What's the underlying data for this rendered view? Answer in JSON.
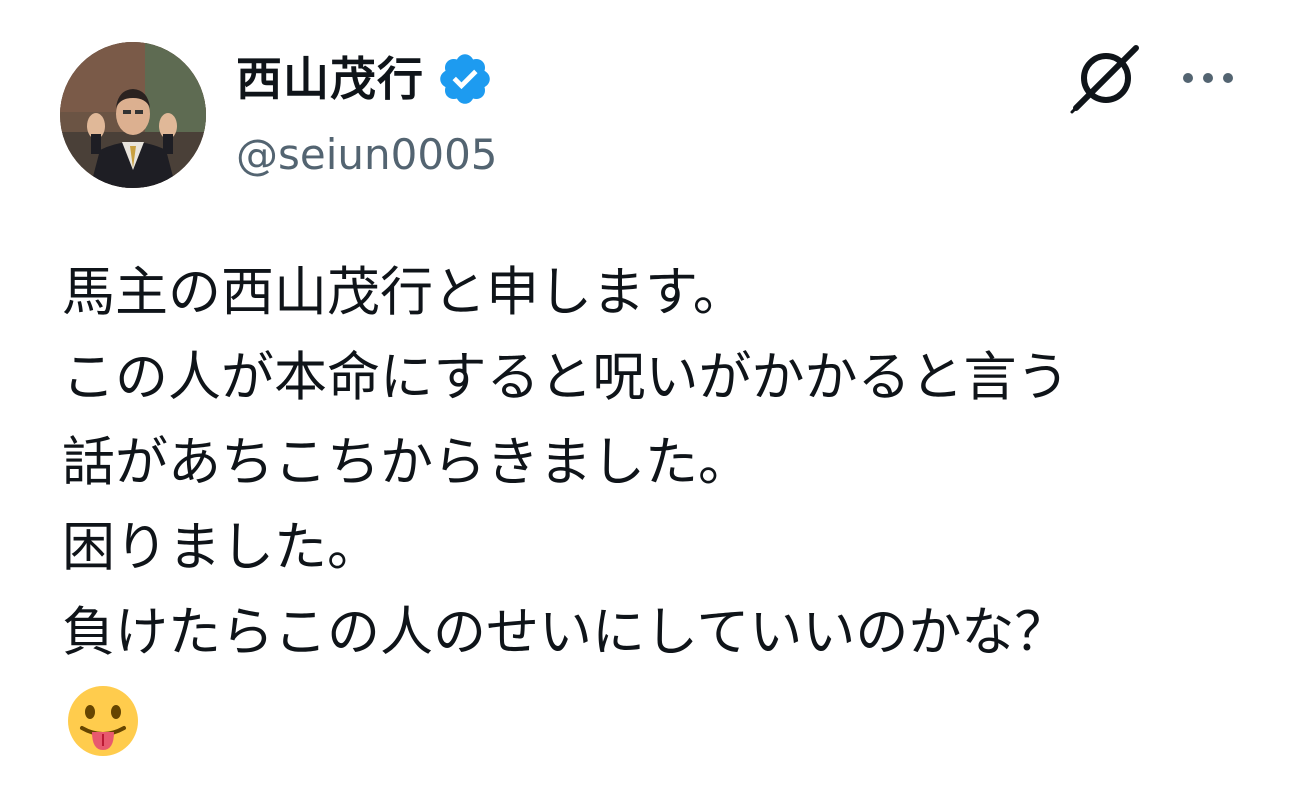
{
  "author": {
    "display_name": "西山茂行",
    "handle": "@seiun0005",
    "verified": true,
    "verified_color": "#1d9bf0",
    "avatar_icon": "profile-photo"
  },
  "actions": {
    "grok_icon": "grok-icon",
    "more_icon": "more-options-icon"
  },
  "tweet": {
    "lines": [
      "馬主の西山茂行と申します。",
      "この人が本命にすると呪いがかかると言う",
      "話があちこちからきました。",
      "困りました。",
      "負けたらこの人のせいにしていいのかな？"
    ],
    "emoji": "face-with-tongue-emoji"
  },
  "colors": {
    "text": "#0f1419",
    "secondary_text": "#536471",
    "background": "#ffffff"
  }
}
